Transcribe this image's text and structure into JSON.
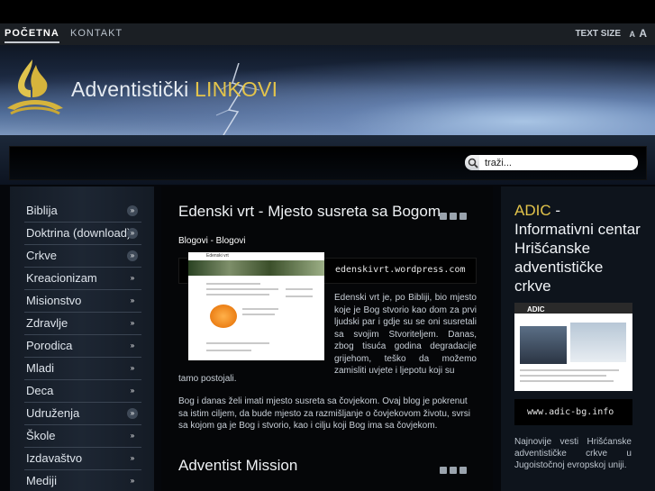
{
  "nav": {
    "home": "POČETNA",
    "contact": "KONTAKT",
    "text_size_label": "TEXT SIZE",
    "text_size_small": "A",
    "text_size_large": "A"
  },
  "header": {
    "title_main": "Adventistički ",
    "title_highlight": "LINKOVI",
    "title_highlight_color": "#e3c44b"
  },
  "search": {
    "value": "traži..."
  },
  "sidebar": {
    "items": [
      {
        "label": "Biblija"
      },
      {
        "label": "Doktrina (download)"
      },
      {
        "label": "Crkve"
      },
      {
        "label": "Kreacionizam"
      },
      {
        "label": "Misionstvo"
      },
      {
        "label": "Zdravlje"
      },
      {
        "label": "Porodica"
      },
      {
        "label": "Mladi"
      },
      {
        "label": "Deca"
      },
      {
        "label": "Udruženja"
      },
      {
        "label": "Škole"
      },
      {
        "label": "Izdavaštvo"
      },
      {
        "label": "Mediji"
      }
    ]
  },
  "main": {
    "article1": {
      "title": "Edenski vrt - Mjesto susreta sa Bogom",
      "category": "Blogovi - Blogovi",
      "url_band": "edenskivrt.wordpress.com",
      "thumb_title": "Edenski vrt",
      "body": "Edenski vrt je, po Bibliji, bio mjesto koje je Bog stvorio kao dom za prvi ljudski par i gdje su se oni susretali sa svojim Stvoriteljem. Danas, zbog tisuća godina degradacije grijehom, teško da možemo zamisliti uvjete i ljepotu koji su",
      "body_tail": "tamo postojali.",
      "paragraph2": "Bog i danas želi imati mjesto susreta sa čovjekom. Ovaj blog je pokrenut sa istim ciljem, da bude mjesto za razmišljanje o čovjekovom životu, svrsi sa kojom ga je Bog i stvorio, kao i cilju koji Bog ima sa čovjekom."
    },
    "article2": {
      "title": "Adventist Mission"
    }
  },
  "right": {
    "title_highlight": "ADIC",
    "title_rest": " - Informativni centar Hrišćanske adventističke crkve",
    "shot_logo": "ADIC",
    "url": "www.adic-bg.info",
    "description": "Najnovije vesti Hrišćanske adventističke crkve u Jugoistočnoj evropskoj uniji."
  }
}
